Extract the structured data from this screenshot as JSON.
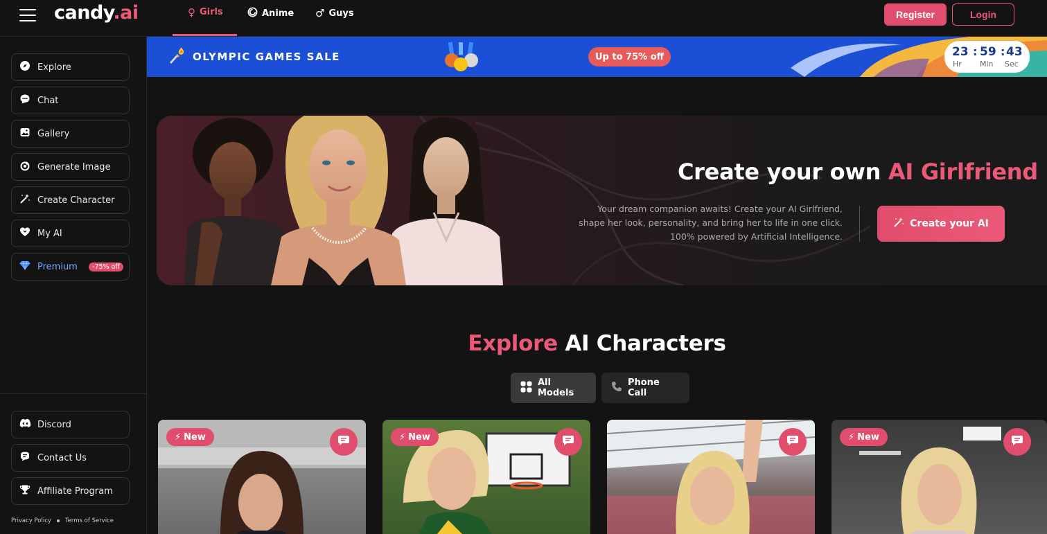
{
  "app": {
    "logo_main": "candy",
    "logo_accent": ".ai"
  },
  "nav": {
    "tabs": [
      {
        "label": "Girls",
        "icon": "female-icon",
        "active": true
      },
      {
        "label": "Anime",
        "icon": "anime-icon",
        "active": false
      },
      {
        "label": "Guys",
        "icon": "male-icon",
        "active": false
      }
    ],
    "register": "Register",
    "login": "Login"
  },
  "sidebar": {
    "items": [
      {
        "label": "Explore",
        "icon": "compass-icon"
      },
      {
        "label": "Chat",
        "icon": "chat-icon"
      },
      {
        "label": "Gallery",
        "icon": "gallery-icon"
      },
      {
        "label": "Generate Image",
        "icon": "generate-image-icon"
      },
      {
        "label": "Create Character",
        "icon": "magic-wand-icon"
      },
      {
        "label": "My AI",
        "icon": "heart-icon"
      },
      {
        "label": "Premium",
        "icon": "diamond-icon",
        "badge": "-75% off"
      }
    ],
    "bottom_items": [
      {
        "label": "Discord",
        "icon": "discord-icon"
      },
      {
        "label": "Contact Us",
        "icon": "contact-icon"
      },
      {
        "label": "Affiliate Program",
        "icon": "trophy-icon"
      }
    ],
    "footer": {
      "privacy": "Privacy Policy",
      "terms": "Terms of Service"
    }
  },
  "sale_banner": {
    "title": "OLYMPIC GAMES SALE",
    "discount": "Up to 75% off",
    "timer": {
      "hours": "23",
      "minutes": "59",
      "seconds": "43",
      "hr_label": "Hr",
      "min_label": "Min",
      "sec_label": "Sec"
    }
  },
  "hero": {
    "title_main": "Create your own ",
    "title_accent": "AI Girlfriend",
    "description": "Your dream companion awaits! Create your AI Girlfriend, shape her look, personality, and bring her to life in one click. 100% powered by Artificial Intelligence.",
    "cta": "Create your AI"
  },
  "explore": {
    "title_accent": "Explore",
    "title_main": " AI Characters",
    "filters": [
      {
        "label": "All Models",
        "icon": "grid-icon",
        "active": true
      },
      {
        "label": "Phone Call",
        "icon": "phone-icon",
        "active": false
      }
    ]
  },
  "cards": [
    {
      "badge": "New"
    },
    {
      "badge": "New"
    },
    {
      "badge": ""
    },
    {
      "badge": "New"
    }
  ],
  "colors": {
    "accent": "#ea5a78",
    "button": "#e14d6c",
    "background": "#131313",
    "banner": "#1a4fd6",
    "premium": "#7aa9ff"
  }
}
